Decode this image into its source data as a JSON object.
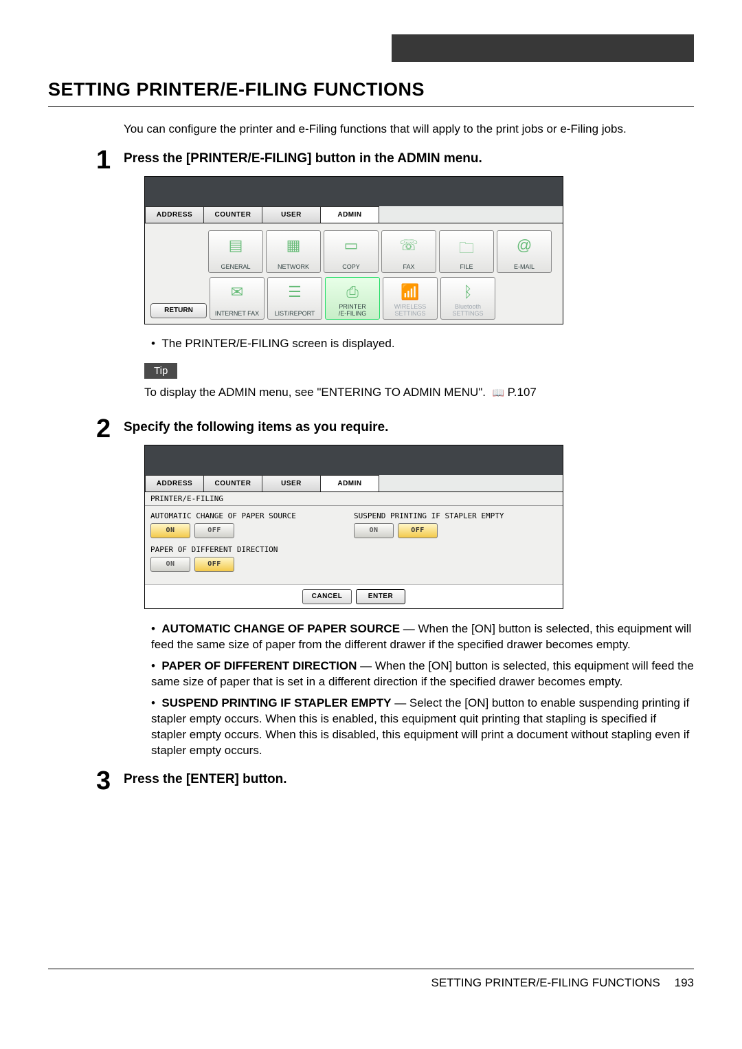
{
  "page_title": "SETTING PRINTER/E-FILING FUNCTIONS",
  "intro": "You can configure the printer and e-Filing functions that will apply to the print jobs or e-Filing jobs.",
  "steps": {
    "s1": {
      "num": "1",
      "title": "Press the [PRINTER/E-FILING] button in the ADMIN menu.",
      "bullet": "The PRINTER/E-FILING screen is displayed."
    },
    "s2": {
      "num": "2",
      "title": "Specify the following items as you require."
    },
    "s3": {
      "num": "3",
      "title": "Press the [ENTER] button."
    }
  },
  "tip": {
    "label": "Tip",
    "text_a": "To display the ADMIN menu, see \"ENTERING TO ADMIN MENU\".",
    "text_b": "P.107"
  },
  "panel1": {
    "tabs": {
      "address": "ADDRESS",
      "counter": "COUNTER",
      "user": "USER",
      "admin": "ADMIN"
    },
    "icons": {
      "general": "GENERAL",
      "network": "NETWORK",
      "copy": "COPY",
      "fax": "FAX",
      "file": "FILE",
      "email": "E-MAIL",
      "ifax": "INTERNET FAX",
      "list": "LIST/REPORT",
      "pef": "PRINTER\n/E-FILING",
      "wireless": "WIRELESS\nSETTINGS",
      "bt": "Bluetooth\nSETTINGS"
    },
    "return": "RETURN"
  },
  "panel2": {
    "crumb": "PRINTER/E-FILING",
    "labels": {
      "auto": "AUTOMATIC CHANGE OF PAPER SOURCE",
      "diff": "PAPER OF DIFFERENT DIRECTION",
      "susp": "SUSPEND PRINTING IF STAPLER EMPTY"
    },
    "btns": {
      "on": "ON",
      "off": "OFF",
      "cancel": "CANCEL",
      "enter": "ENTER"
    }
  },
  "desc": {
    "auto_h": "AUTOMATIC CHANGE OF PAPER SOURCE",
    "auto_t": " — When the [ON] button is selected, this equipment will feed the same size of paper from the different drawer if the specified drawer becomes empty.",
    "diff_h": "PAPER OF DIFFERENT DIRECTION",
    "diff_t": " — When the [ON] button is selected, this equipment will feed the same size of paper that is set in a different direction if the specified drawer becomes empty.",
    "susp_h": "SUSPEND PRINTING IF STAPLER EMPTY",
    "susp_t": " — Select the [ON] button to enable suspending printing if stapler empty occurs.  When this is enabled, this equipment quit printing that stapling is specified if stapler empty occurs.  When this is disabled, this equipment will print a document without stapling even if stapler empty occurs."
  },
  "footer": {
    "text": "SETTING PRINTER/E-FILING FUNCTIONS",
    "page": "193"
  }
}
